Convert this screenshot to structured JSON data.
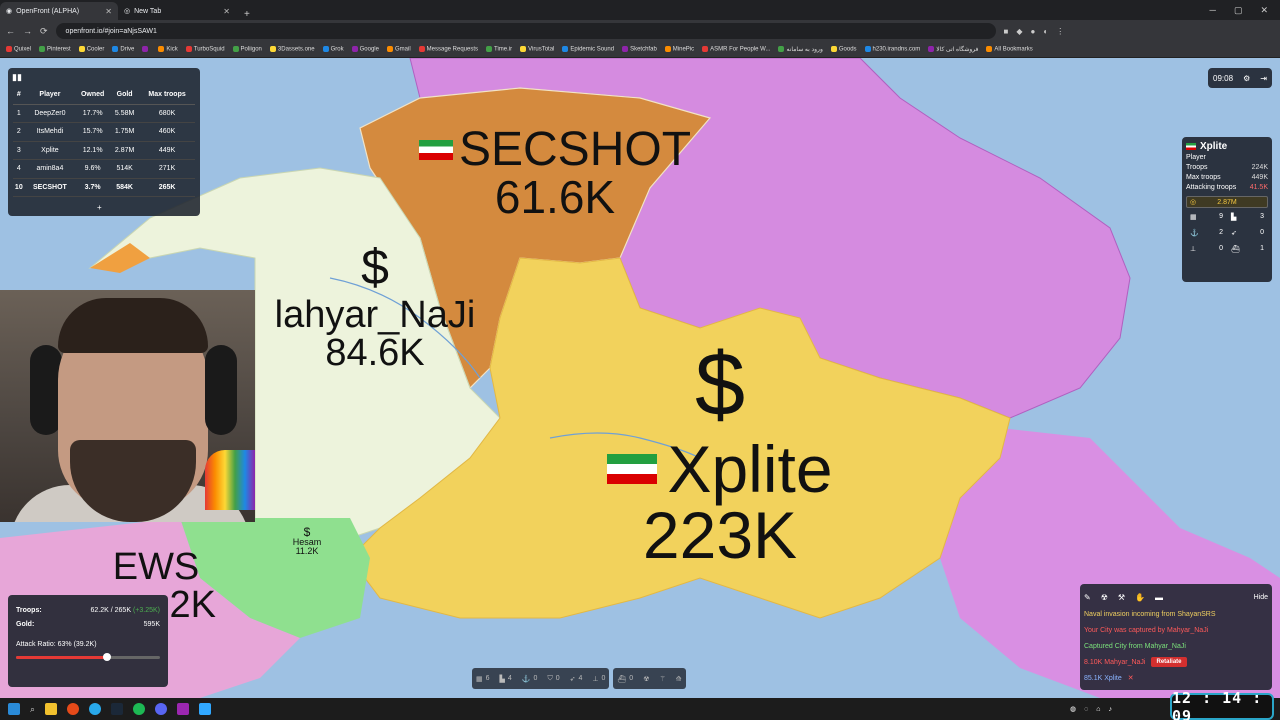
{
  "browser": {
    "tabs": [
      {
        "title": "OpenFront (ALPHA)",
        "active": true
      },
      {
        "title": "New Tab",
        "active": false
      }
    ],
    "url": "openfront.io/#join=aNjsSAW1",
    "bookmarks": [
      "Quixel",
      "Pinterest",
      "Cooler",
      "Drive",
      "",
      "Kick",
      "TurboSquid",
      "Poliigon",
      "3Dassets.one",
      "Grok",
      "Google",
      "Gmail",
      "Message Requests",
      "Time.ir",
      "VirusTotal",
      "Epidemic Sound",
      "Sketchfab",
      "MinePic",
      "ASMR For People W...",
      "ورود به سامانه",
      "Goods",
      "h230.irandns.com",
      "فروشگاه اتی کالا",
      "All Bookmarks"
    ]
  },
  "leaderboard": {
    "headers": [
      "#",
      "Player",
      "Owned",
      "Gold",
      "Max troops"
    ],
    "rows": [
      {
        "rank": "1",
        "player": "DeepZer0",
        "owned": "17.7%",
        "gold": "5.58M",
        "max": "680K"
      },
      {
        "rank": "2",
        "player": "ItsMehdi",
        "owned": "15.7%",
        "gold": "1.75M",
        "max": "460K"
      },
      {
        "rank": "3",
        "player": "Xplite",
        "owned": "12.1%",
        "gold": "2.87M",
        "max": "449K"
      },
      {
        "rank": "4",
        "player": "amin8a4",
        "owned": "9.6%",
        "gold": "514K",
        "max": "271K"
      },
      {
        "rank": "10",
        "player": "SECSHOT",
        "owned": "3.7%",
        "gold": "584K",
        "max": "265K"
      }
    ],
    "more": "+"
  },
  "map_labels": {
    "secshot_name": "SECSHOT",
    "secshot_troops": "61.6K",
    "mahyar_name": "lahyar_NaJi",
    "mahyar_troops": "84.6K",
    "xplite_name": "Xplite",
    "xplite_troops": "223K",
    "ews_name": "EWS",
    "ews_troops": "2K",
    "hesam_name": "Hesam",
    "hesam_troops": "11.2K"
  },
  "timer": {
    "time": "09:08"
  },
  "player_panel": {
    "name": "Xplite",
    "type": "Player",
    "troops_label": "Troops",
    "troops": "224K",
    "max_label": "Max troops",
    "max": "449K",
    "attacking_label": "Attacking troops",
    "attacking": "41.5K",
    "gold": "2.87M",
    "stats": [
      "9",
      "3",
      "2",
      "0",
      "0",
      "1"
    ]
  },
  "troop_panel": {
    "troops_label": "Troops:",
    "troops": "62.2K / 265K",
    "troops_rate": "(+3.25K)",
    "gold_label": "Gold:",
    "gold": "595K",
    "ratio_label": "Attack Ratio: 63% (39.2K)",
    "ratio": 0.63
  },
  "build_bar": [
    "6",
    "4",
    "0",
    "0",
    "4",
    "0",
    "0"
  ],
  "events": {
    "hide_label": "Hide",
    "messages": [
      {
        "text": "Naval invasion incoming from ShayanSRS",
        "color": "yellow"
      },
      {
        "text": "Your City was captured by Mahyar_NaJi",
        "color": "red"
      },
      {
        "text": "Captured City from Mahyar_NaJi",
        "color": "green"
      }
    ],
    "attack_text": "8.10K Mahyar_NaJi",
    "retaliate_label": "Retaliate",
    "outgoing_text": "85.1K Xplite"
  },
  "clock": "12 : 14 : 09"
}
